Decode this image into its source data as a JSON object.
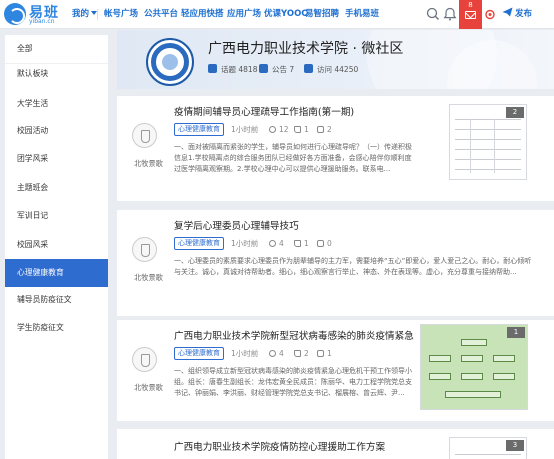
{
  "topbar": {
    "logo_cn": "易班",
    "logo_en": "yiban.cn",
    "nav": [
      "我的",
      "帐号广场",
      "公共平台",
      "轻应用快搭",
      "应用广场",
      "优课YOOC",
      "易智招聘",
      "手机易班"
    ],
    "notification_count": "8",
    "publish_label": "发布"
  },
  "sidebar": {
    "items": [
      "全部",
      "默认板块",
      "大学生活",
      "校园活动",
      "团学风采",
      "主题班会",
      "军训日记",
      "校园风采",
      "心理健康教育",
      "辅导员防疫征文",
      "学生防疫征文"
    ],
    "active_index": 8
  },
  "header": {
    "title": "广西电力职业技术学院 · 微社区",
    "topics": "话题 4818",
    "announcements": "公告 7",
    "visits": "访问 44250"
  },
  "posts": [
    {
      "title": "疫情期间辅导员心理疏导工作指南(第一期)",
      "tag": "心理健康教育",
      "time": "1小时前",
      "views": "12",
      "likes": "1",
      "comments": "2",
      "author": "北牧景歌",
      "body": "一、面对被隔离而紧张的学生，辅导员如何进行心理疏导呢？（一）传递积极信息1.学校隔离点的综合服务团队已经做好各方面准备，会感心陪伴你顺利度过医学隔离观察期。2.学校心理中心可以提供心理援助服务。联系电...",
      "image_count": "2"
    },
    {
      "title": "复学后心理委员心理辅导技巧",
      "tag": "心理健康教育",
      "time": "1小时前",
      "views": "4",
      "likes": "1",
      "comments": "0",
      "author": "北牧景歌",
      "body": "一、心理委员的素质要求心理委员作为朋辈辅导的主力军，需要培养“五心”即爱心，爱人爱己之心。耐心，耐心倾听与关注。诚心，真诚对待帮助者。细心，细心观察言行举止、神态、外在表现等。虚心，充分尊重与接纳帮助...",
      "image_count": ""
    },
    {
      "title": "广西电力职业技术学院新型冠状病毒感染的肺炎疫情紧急...",
      "tag": "心理健康教育",
      "time": "1小时前",
      "views": "4",
      "likes": "2",
      "comments": "1",
      "author": "北牧景歌",
      "body": "一、组织领导成立新型冠状病毒感染的肺炎疫情紧急心理危机干预工作领导小组。组长：唐春生副组长：龙伟宏黄全民成员：陈丽华、电力工程学院党总支书记、钟丽娟、李洪丽、财经管理学院党总支书记、榴展榕、曾云辉、尹...",
      "image_count": "1"
    },
    {
      "title": "广西电力职业技术学院疫情防控心理援助工作方案",
      "tag": "",
      "time": "",
      "views": "",
      "likes": "",
      "comments": "",
      "author": "",
      "body": "",
      "image_count": "3"
    }
  ],
  "colors": {
    "brand_blue": "#2f6ccf",
    "nav_blue": "#1d6fd1",
    "notification_red": "#e7433c",
    "page_bg": "#e9edf2"
  },
  "icons": [
    "search-icon",
    "bell-icon",
    "mail-icon",
    "settings-icon",
    "send-icon",
    "views-icon",
    "likes-icon",
    "comments-icon",
    "school-emblem-icon"
  ]
}
